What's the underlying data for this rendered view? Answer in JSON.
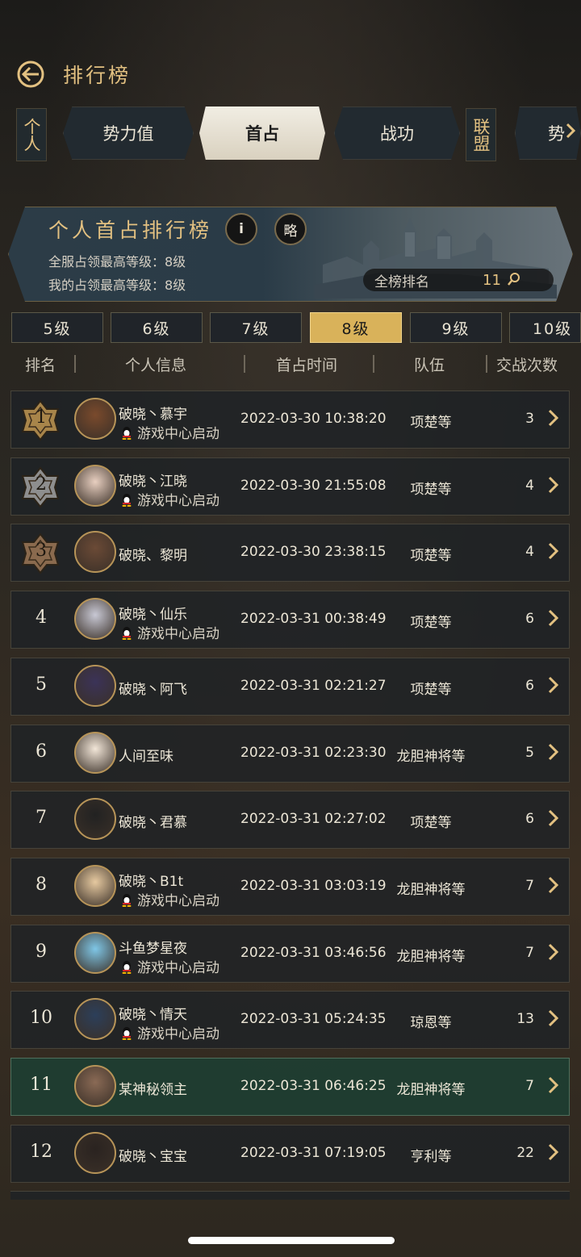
{
  "header": {
    "title": "排行榜"
  },
  "category_tabs": {
    "left_side": "个人",
    "tabs": [
      "势力值",
      "首占",
      "战功"
    ],
    "active_tab": "首占",
    "right_side": "联盟",
    "overflow_tab": "势"
  },
  "banner": {
    "title": "个人首占排行榜",
    "info_button": "i",
    "short_button": "略",
    "server_max_line": "全服占领最高等级：8级",
    "my_max_line": "我的占领最高等级：8级",
    "rank_label": "全榜排名",
    "rank_value": "11"
  },
  "level_tabs": {
    "items": [
      "5级",
      "6级",
      "7级",
      "8级",
      "9级",
      "10级"
    ],
    "active": "8级"
  },
  "columns": [
    "排名",
    "个人信息",
    "首占时间",
    "队伍",
    "交战次数"
  ],
  "rows": [
    {
      "rank": "1",
      "name": "破晓丶慕宇",
      "sub": "游戏中心启动",
      "time": "2022-03-30 10:38:20",
      "team": "项楚等",
      "count": "3",
      "avatar_color": "#7a4a2c"
    },
    {
      "rank": "2",
      "name": "破晓丶江晓",
      "sub": "游戏中心启动",
      "time": "2022-03-30 21:55:08",
      "team": "项楚等",
      "count": "4",
      "avatar_color": "#e8cfc0"
    },
    {
      "rank": "3",
      "name": "破晓、黎明",
      "sub": "",
      "time": "2022-03-30 23:38:15",
      "team": "项楚等",
      "count": "4",
      "avatar_color": "#6b4a36"
    },
    {
      "rank": "4",
      "name": "破晓丶仙乐",
      "sub": "游戏中心启动",
      "time": "2022-03-31 00:38:49",
      "team": "项楚等",
      "count": "6",
      "avatar_color": "#c8c8d4"
    },
    {
      "rank": "5",
      "name": "破晓丶阿飞",
      "sub": "",
      "time": "2022-03-31 02:21:27",
      "team": "项楚等",
      "count": "6",
      "avatar_color": "#3b3358"
    },
    {
      "rank": "6",
      "name": "人间至味",
      "sub": "",
      "time": "2022-03-31 02:23:30",
      "team": "龙胆神将等",
      "count": "5",
      "avatar_color": "#f2e6d8"
    },
    {
      "rank": "7",
      "name": "破晓丶君慕",
      "sub": "",
      "time": "2022-03-31 02:27:02",
      "team": "项楚等",
      "count": "6",
      "avatar_color": "#222222"
    },
    {
      "rank": "8",
      "name": "破晓丶B1t",
      "sub": "游戏中心启动",
      "time": "2022-03-31 03:03:19",
      "team": "龙胆神将等",
      "count": "7",
      "avatar_color": "#e6c9a0"
    },
    {
      "rank": "9",
      "name": "斗鱼梦星夜",
      "sub": "游戏中心启动",
      "time": "2022-03-31 03:46:56",
      "team": "龙胆神将等",
      "count": "7",
      "avatar_color": "#7fc6e6"
    },
    {
      "rank": "10",
      "name": "破晓丶情天",
      "sub": "游戏中心启动",
      "time": "2022-03-31 05:24:35",
      "team": "琼恩等",
      "count": "13",
      "avatar_color": "#2c3f5a"
    },
    {
      "rank": "11",
      "name": "某神秘领主",
      "sub": "",
      "time": "2022-03-31 06:46:25",
      "team": "龙胆神将等",
      "count": "7",
      "avatar_color": "#8a6a55",
      "me": true
    },
    {
      "rank": "12",
      "name": "破晓丶宝宝",
      "sub": "",
      "time": "2022-03-31 07:19:05",
      "team": "亨利等",
      "count": "22",
      "avatar_color": "#2a2320"
    }
  ],
  "colors": {
    "gold": "#e3c181",
    "active_level": "#d9b25a",
    "self_row": "#1c4032"
  }
}
